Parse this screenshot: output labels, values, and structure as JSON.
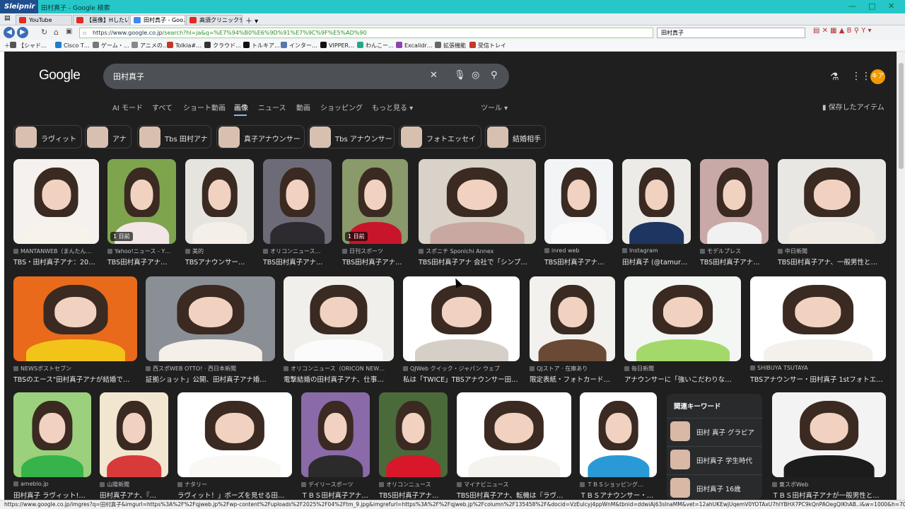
{
  "titlebar": {
    "app": "Sleipnir",
    "title": "田村真子 - Google 検索"
  },
  "tabs": [
    {
      "label": "YouTube",
      "color": "#e02b20"
    },
    {
      "label": "【画像】Hしたい女…",
      "color": "#e02b20"
    },
    {
      "label": "田村真子 - Goo…",
      "color": "#4285f4"
    },
    {
      "label": "高須クリニックチャ…",
      "color": "#e02b20"
    }
  ],
  "nav": {
    "url_prefix": "https://www.google.co.jp",
    "url_rest": "/search?hl=ja&q=%E7%94%B0%E6%9D%91%E7%9C%9F%E5%AD%90",
    "search_value": "田村真子"
  },
  "bookmarks": [
    {
      "label": "【シャド…",
      "color": "#555"
    },
    {
      "label": "Cisco T…",
      "color": "#1b7fd1"
    },
    {
      "label": "ゲーム・…",
      "color": "#777"
    },
    {
      "label": "アニメの…",
      "color": "#888"
    },
    {
      "label": "Tolkia#…",
      "color": "#c0392b"
    },
    {
      "label": "クラウド…",
      "color": "#333"
    },
    {
      "label": "トルキア…",
      "color": "#111"
    },
    {
      "label": "インター…",
      "color": "#5577aa"
    },
    {
      "label": "VIPPER…",
      "color": "#111"
    },
    {
      "label": "わんこー…",
      "color": "#2a8"
    },
    {
      "label": "Excalidr…",
      "color": "#8e44ad"
    },
    {
      "label": "拡張機能",
      "color": "#666"
    },
    {
      "label": "受信トレイ",
      "color": "#c0392b"
    }
  ],
  "google": {
    "logo": "Google",
    "query": "田村真子",
    "avatar": "キア",
    "filters": [
      "AI モード",
      "すべて",
      "ショート動画",
      "画像",
      "ニュース",
      "動画",
      "ショッピング",
      "もっと見る ▾",
      "ツール ▾"
    ],
    "saved": "保存したアイテム",
    "chips": [
      "ラヴィット",
      "アナ",
      "Tbs 田村アナ",
      "真子アナウンサー",
      "Tbs アナウンサー",
      "フォトエッセイ",
      "結婚相手"
    ]
  },
  "results": [
    {
      "source": "MANTANWEB（まんたん…",
      "title": "TBS・田村真子アナ：20…",
      "badge": ""
    },
    {
      "source": "Yahoo!ニュース - Y…",
      "title": "TBS田村真子アナ…",
      "badge": "1 日前"
    },
    {
      "source": "美的",
      "title": "TBSアナウンサー…",
      "badge": ""
    },
    {
      "source": "オリコンニュース…",
      "title": "TBS田村真子アナ…",
      "badge": ""
    },
    {
      "source": "日刊スポーツ",
      "title": "TBS田村真子アナ…",
      "badge": "1 日前"
    },
    {
      "source": "スポニチ Sponichi Annex",
      "title": "TBS田村真子アナ 会社で「シンプ…",
      "badge": ""
    },
    {
      "source": "inred web",
      "title": "TBS田村真子アナ…",
      "badge": ""
    },
    {
      "source": "Instagram",
      "title": "田村真子 (@tamur…",
      "badge": ""
    },
    {
      "source": "モデルプレス",
      "title": "TBS田村真子アナ…",
      "badge": ""
    },
    {
      "source": "中日新聞",
      "title": "TBS田村真子アナ、一般男性と…",
      "badge": ""
    },
    {
      "source": "NEWSポストセブン",
      "title": "TBSのエース\"田村真子アナが結婚で…",
      "badge": ""
    },
    {
      "source": "西スポWEB OTTO! · 西日本新聞",
      "title": "証拠ショット」公開、田村真子アナ婚…",
      "badge": ""
    },
    {
      "source": "オリコンニュース（ORICON NEW…",
      "title": "電撃結婚の田村真子アナ、仕事…",
      "badge": ""
    },
    {
      "source": "QJWeb クイック・ジャパン ウェブ",
      "title": "私は「TWICE」TBSアナウンサー田…",
      "badge": ""
    },
    {
      "source": "QJストア · 在庫あり",
      "title": "限定表紙・フォトカード…",
      "badge": ""
    },
    {
      "source": "毎日新聞",
      "title": "アナウンサーに「強いこだわりな…",
      "badge": ""
    },
    {
      "source": "SHIBUYA TSUTAYA",
      "title": "TBSアナウンサー・田村真子 1stフォトエ…",
      "badge": ""
    },
    {
      "source": "ameblo.jp",
      "title": "田村真子 ラヴィット!…",
      "badge": ""
    },
    {
      "source": "山陽新聞",
      "title": "田村真子アナ、『…",
      "badge": ""
    },
    {
      "source": "ナタリー",
      "title": "ラヴィット！」ポーズを見せる田…",
      "badge": ""
    },
    {
      "source": "デイリースポーツ",
      "title": "ＴＢＳ田村真子アナ…",
      "badge": ""
    },
    {
      "source": "オリコンニュース",
      "title": "TBS田村真子アナ…",
      "badge": ""
    },
    {
      "source": "マイナビニュース",
      "title": "TBS田村真子アナ、転機は『ラヴ…",
      "badge": ""
    },
    {
      "source": "ＴＢＳショッピング…",
      "title": "ＴＢＳアナウンサー・…",
      "badge": ""
    },
    {
      "source": "東スポWeb",
      "title": "ＴＢＳ田村真子アナが一般男性と…",
      "badge": ""
    }
  ],
  "related": {
    "heading": "関連キーワード",
    "items": [
      "田村 真子 グラビア",
      "田村真子 学生時代",
      "田村真子 16歳"
    ]
  },
  "status": "https://www.google.co.jp/imgres?q=田村真子&imgurl=https%3A%2F%2Fqjweb.jp%2Fwp-content%2Fuploads%2F2025%2F04%2Ftm_9.jpg&imgrefurl=https%3A%2F%2Fqjweb.jp%2Fcolumn%2F135458%2F&docid=VzEulcyj4ppWnM&tbnid=ddwiAj63sInaMM&vet=12ahUKEwjUqemV0YOTAxU7hlYBHX7PC9kQnPAOegQIKhAB..i&w=1000&h=706&hcb="
}
